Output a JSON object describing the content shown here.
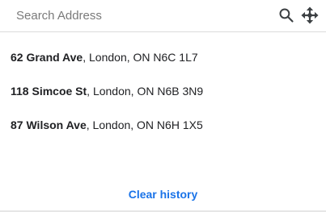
{
  "search": {
    "placeholder": "Search Address",
    "value": "",
    "search_icon": "search-icon",
    "move_icon": "move-arrows-icon"
  },
  "history": [
    {
      "street": "62 Grand Ave",
      "rest": ", London, ON N6C 1L7"
    },
    {
      "street": "118 Simcoe St",
      "rest": ", London, ON N6B 3N9"
    },
    {
      "street": "87 Wilson Ave",
      "rest": ", London, ON N6H 1X5"
    }
  ],
  "clear_label": "Clear history",
  "colors": {
    "link": "#1a73e8",
    "text": "#202124",
    "icon": "#3c4043"
  }
}
